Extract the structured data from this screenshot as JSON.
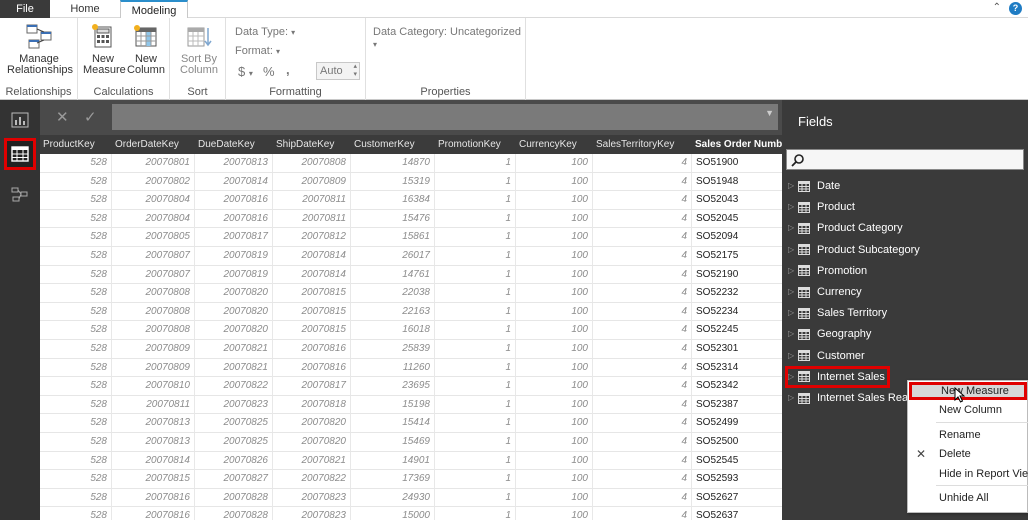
{
  "tabs": {
    "file": "File",
    "home": "Home",
    "modeling": "Modeling"
  },
  "ribbon": {
    "manage_relationships": "Manage Relationships",
    "group_relationships": "Relationships",
    "new_measure": "New Measure",
    "new_column": "New Column",
    "group_calculations": "Calculations",
    "sort_by_column": "Sort By Column",
    "group_sort": "Sort",
    "data_type": "Data Type:",
    "format": "Format:",
    "currency_symbol": "$",
    "percent_symbol": "%",
    "comma_symbol": ",",
    "auto": "Auto",
    "group_formatting": "Formatting",
    "data_category": "Data Category: Uncategorized",
    "group_properties": "Properties"
  },
  "formula": {
    "cancel": "✕",
    "commit": "✓"
  },
  "grid": {
    "columns": [
      "ProductKey",
      "OrderDateKey",
      "DueDateKey",
      "ShipDateKey",
      "CustomerKey",
      "PromotionKey",
      "CurrencyKey",
      "SalesTerritoryKey",
      "Sales Order Numbe"
    ],
    "rows": [
      [
        "528",
        "20070801",
        "20070813",
        "20070808",
        "14870",
        "1",
        "100",
        "4",
        "SO51900"
      ],
      [
        "528",
        "20070802",
        "20070814",
        "20070809",
        "15319",
        "1",
        "100",
        "4",
        "SO51948"
      ],
      [
        "528",
        "20070804",
        "20070816",
        "20070811",
        "16384",
        "1",
        "100",
        "4",
        "SO52043"
      ],
      [
        "528",
        "20070804",
        "20070816",
        "20070811",
        "15476",
        "1",
        "100",
        "4",
        "SO52045"
      ],
      [
        "528",
        "20070805",
        "20070817",
        "20070812",
        "15861",
        "1",
        "100",
        "4",
        "SO52094"
      ],
      [
        "528",
        "20070807",
        "20070819",
        "20070814",
        "26017",
        "1",
        "100",
        "4",
        "SO52175"
      ],
      [
        "528",
        "20070807",
        "20070819",
        "20070814",
        "14761",
        "1",
        "100",
        "4",
        "SO52190"
      ],
      [
        "528",
        "20070808",
        "20070820",
        "20070815",
        "22038",
        "1",
        "100",
        "4",
        "SO52232"
      ],
      [
        "528",
        "20070808",
        "20070820",
        "20070815",
        "22163",
        "1",
        "100",
        "4",
        "SO52234"
      ],
      [
        "528",
        "20070808",
        "20070820",
        "20070815",
        "16018",
        "1",
        "100",
        "4",
        "SO52245"
      ],
      [
        "528",
        "20070809",
        "20070821",
        "20070816",
        "25839",
        "1",
        "100",
        "4",
        "SO52301"
      ],
      [
        "528",
        "20070809",
        "20070821",
        "20070816",
        "11260",
        "1",
        "100",
        "4",
        "SO52314"
      ],
      [
        "528",
        "20070810",
        "20070822",
        "20070817",
        "23695",
        "1",
        "100",
        "4",
        "SO52342"
      ],
      [
        "528",
        "20070811",
        "20070823",
        "20070818",
        "15198",
        "1",
        "100",
        "4",
        "SO52387"
      ],
      [
        "528",
        "20070813",
        "20070825",
        "20070820",
        "15414",
        "1",
        "100",
        "4",
        "SO52499"
      ],
      [
        "528",
        "20070813",
        "20070825",
        "20070820",
        "15469",
        "1",
        "100",
        "4",
        "SO52500"
      ],
      [
        "528",
        "20070814",
        "20070826",
        "20070821",
        "14901",
        "1",
        "100",
        "4",
        "SO52545"
      ],
      [
        "528",
        "20070815",
        "20070827",
        "20070822",
        "17369",
        "1",
        "100",
        "4",
        "SO52593"
      ],
      [
        "528",
        "20070816",
        "20070828",
        "20070823",
        "24930",
        "1",
        "100",
        "4",
        "SO52627"
      ],
      [
        "528",
        "20070816",
        "20070828",
        "20070823",
        "15000",
        "1",
        "100",
        "4",
        "SO52637"
      ]
    ]
  },
  "fields": {
    "title": "Fields",
    "items": [
      "Date",
      "Product",
      "Product Category",
      "Product Subcategory",
      "Promotion",
      "Currency",
      "Sales Territory",
      "Geography",
      "Customer",
      "Internet Sales",
      "Internet Sales Reaso"
    ]
  },
  "context_menu": {
    "new_measure": "New Measure",
    "new_column": "New Column",
    "rename": "Rename",
    "delete": "Delete",
    "hide_in_report_view": "Hide in Report View",
    "unhide_all": "Unhide All"
  },
  "colors": {
    "accent": "#2b8ecb",
    "highlight": "#e00000",
    "dark_bg": "#333333"
  }
}
